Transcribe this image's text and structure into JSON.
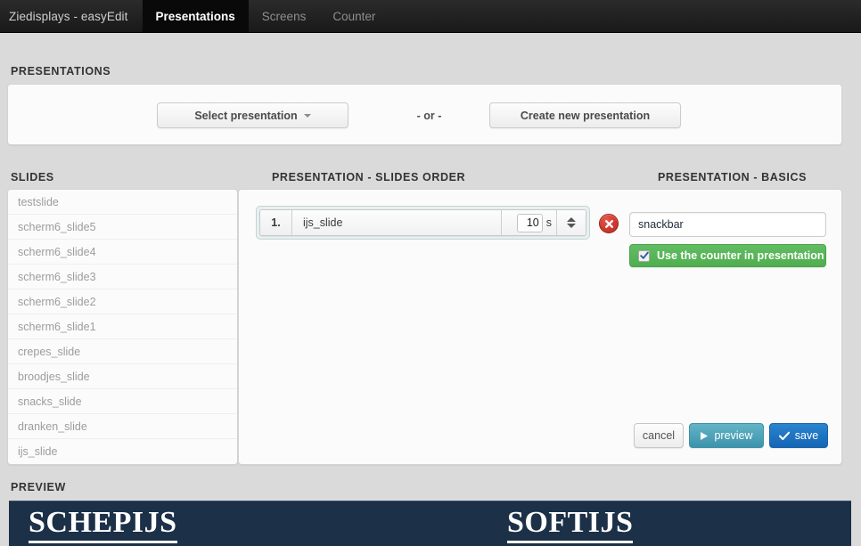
{
  "navbar": {
    "brand": "Ziedisplays - easyEdit",
    "tabs": [
      {
        "label": "Presentations",
        "active": true
      },
      {
        "label": "Screens",
        "active": false
      },
      {
        "label": "Counter",
        "active": false
      }
    ]
  },
  "sections": {
    "presentations_label": "PRESENTATIONS",
    "slides_label": "SLIDES",
    "slides_order_label": "PRESENTATION - SLIDES ORDER",
    "basics_label": "PRESENTATION - BASICS",
    "preview_label": "PREVIEW"
  },
  "presentations": {
    "select_button": "Select presentation",
    "or_text": "- or -",
    "create_button": "Create new presentation"
  },
  "slides_list": [
    {
      "label": "testslide"
    },
    {
      "label": "scherm6_slide5"
    },
    {
      "label": "scherm6_slide4"
    },
    {
      "label": "scherm6_slide3"
    },
    {
      "label": "scherm6_slide2"
    },
    {
      "label": "scherm6_slide1"
    },
    {
      "label": "crepes_slide"
    },
    {
      "label": "broodjes_slide"
    },
    {
      "label": "snacks_slide"
    },
    {
      "label": "dranken_slide"
    },
    {
      "label": "ijs_slide"
    }
  ],
  "slides_order": [
    {
      "index": "1.",
      "name": "ijs_slide",
      "duration": "10",
      "duration_unit": "s"
    }
  ],
  "basics": {
    "name_value": "snackbar",
    "name_placeholder": "",
    "counter_label": "Use the counter in presentation",
    "counter_checked": true
  },
  "actions": {
    "cancel": "cancel",
    "preview": "preview",
    "save": "save"
  },
  "preview": {
    "background_color": "#1c3048",
    "words": [
      {
        "text": "SCHEPIJS"
      },
      {
        "text": "SOFTIJS"
      }
    ]
  },
  "colors": {
    "navbar": "#222222",
    "page_background": "#dadada",
    "panel": "#fbfbfb",
    "green_button": "#4fae4f",
    "blue_save": "#1565b5",
    "teal_preview": "#3d93ac",
    "delete_red": "#cf3a2f"
  }
}
